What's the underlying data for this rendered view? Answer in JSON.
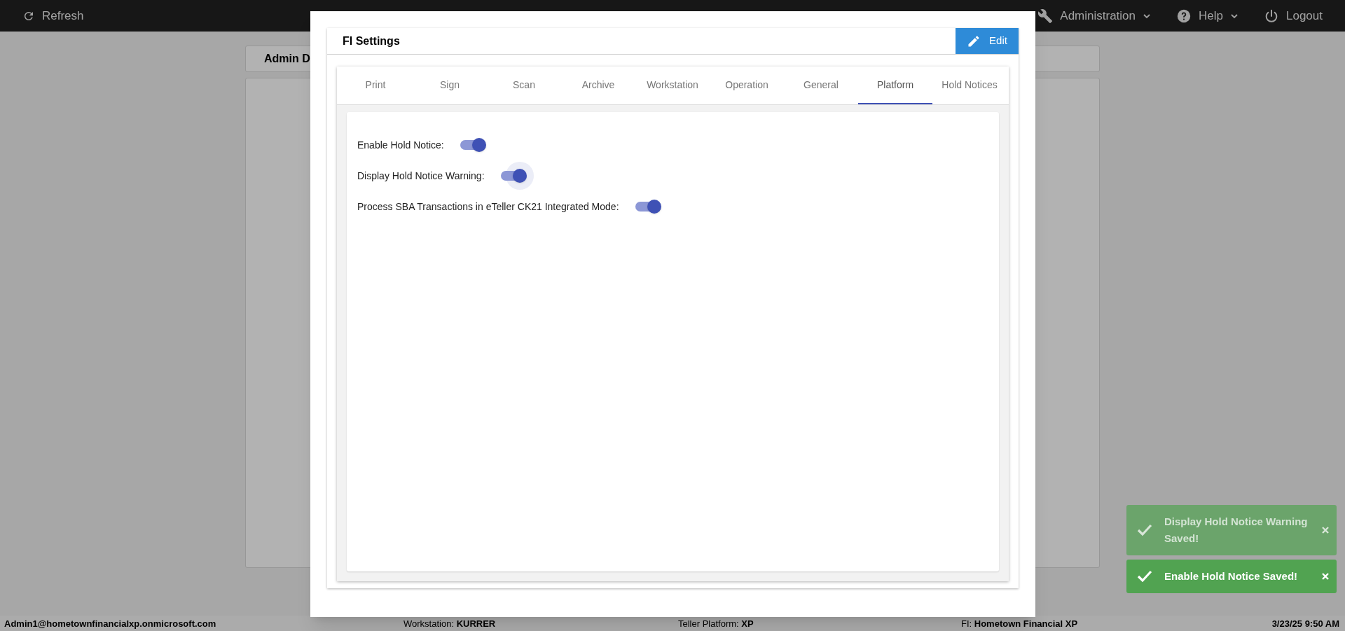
{
  "top_bar": {
    "refresh": "Refresh",
    "menus": [
      {
        "label": "Administration",
        "kind": "tools",
        "dropdown": true
      },
      {
        "label": "Help",
        "kind": "help",
        "dropdown": true
      },
      {
        "label": "Logout",
        "kind": "logout",
        "dropdown": false
      }
    ]
  },
  "background": {
    "header": "Admin D"
  },
  "status_bar": {
    "user": "Admin1@hometownfinancialxp.onmicrosoft.com",
    "fields": [
      {
        "label": "Workstation:",
        "value": "KURRER"
      },
      {
        "label": "Teller Platform:",
        "value": "XP"
      },
      {
        "label": "FI:",
        "value": "Hometown Financial XP"
      }
    ],
    "datetime": "3/23/25 9:50 AM"
  },
  "dialog": {
    "title": "FI Settings",
    "edit_button": "Edit",
    "tabs": [
      {
        "label": "Print",
        "selected": false
      },
      {
        "label": "Sign",
        "selected": false
      },
      {
        "label": "Scan",
        "selected": false
      },
      {
        "label": "Archive",
        "selected": false
      },
      {
        "label": "Workstation",
        "selected": false
      },
      {
        "label": "Operation",
        "selected": false
      },
      {
        "label": "General",
        "selected": false
      },
      {
        "label": "Platform",
        "selected": true
      },
      {
        "label": "Hold Notices",
        "selected": false
      }
    ],
    "settings": [
      {
        "label": "Enable Hold Notice:",
        "on": true,
        "focused": false
      },
      {
        "label": "Display Hold Notice Warning:",
        "on": true,
        "focused": true
      },
      {
        "label": "Process SBA Transactions in eTeller CK21 Integrated Mode:",
        "on": true,
        "focused": false
      }
    ]
  },
  "toasts": [
    {
      "message": "Display Hold Notice Warning Saved!",
      "faded": true
    },
    {
      "message": "Enable Hold Notice Saved!",
      "faded": false
    }
  ]
}
